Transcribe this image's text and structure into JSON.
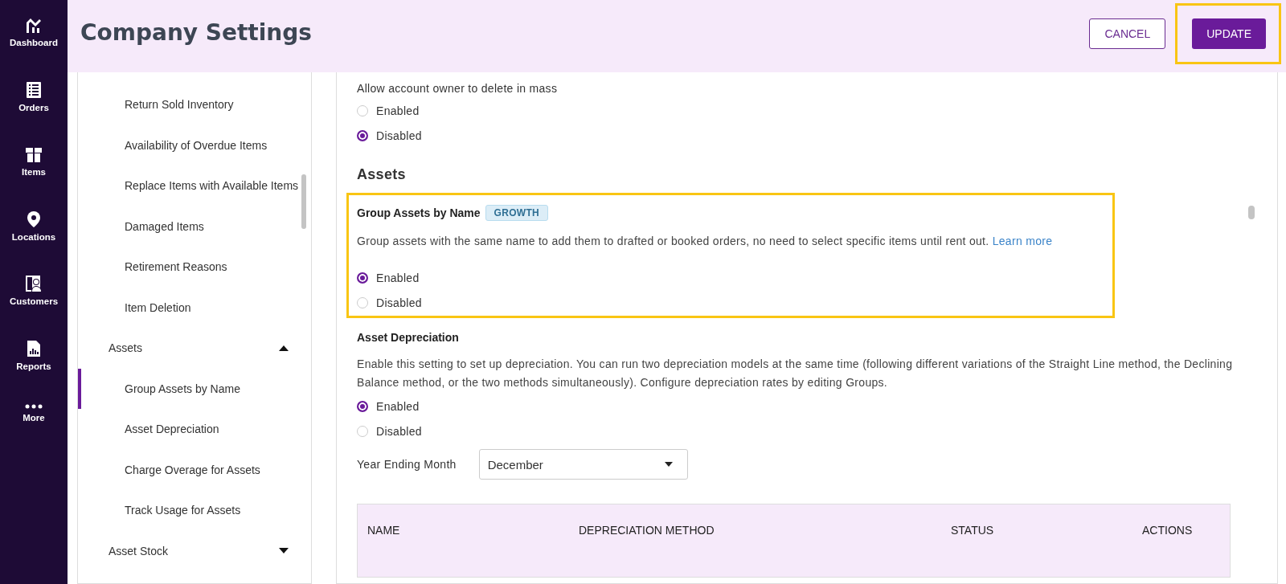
{
  "nav": [
    {
      "label": "Dashboard"
    },
    {
      "label": "Orders"
    },
    {
      "label": "Items"
    },
    {
      "label": "Locations"
    },
    {
      "label": "Customers"
    },
    {
      "label": "Reports"
    },
    {
      "label": "More"
    }
  ],
  "header": {
    "title": "Company Settings",
    "cancel": "CANCEL",
    "update": {
      "label": "UPDATE",
      "highlighted": true
    }
  },
  "settings_nav": [
    {
      "label": "Return Sold Inventory",
      "selected": false
    },
    {
      "label": "Availability of Overdue Items",
      "selected": false
    },
    {
      "label": "Replace Items with Available Items",
      "selected": false
    },
    {
      "label": "Damaged Items",
      "selected": false
    },
    {
      "label": "Retirement Reasons",
      "selected": false
    },
    {
      "label": "Item Deletion",
      "selected": false
    },
    {
      "label": "Assets",
      "expanded": true,
      "children": [
        {
          "label": "Group Assets by Name",
          "selected": true
        },
        {
          "label": "Asset Depreciation",
          "selected": false
        },
        {
          "label": "Charge Overage for Assets",
          "selected": false
        },
        {
          "label": "Track Usage for Assets",
          "selected": false
        }
      ]
    },
    {
      "label": "Asset Stock",
      "expanded": false
    }
  ],
  "content": {
    "mass_delete": {
      "label": "Allow account owner to delete in mass",
      "options": [
        {
          "label": "Enabled",
          "selected": false
        },
        {
          "label": "Disabled",
          "selected": true
        }
      ]
    },
    "section_title": "Assets",
    "group_assets": {
      "title": "Group Assets by Name",
      "badge": "GROWTH",
      "highlighted": true,
      "description": "Group assets with the same name to add them to drafted or booked orders, no need to select specific items until rent out.",
      "link": "Learn more",
      "options": [
        {
          "label": "Enabled",
          "selected": true
        },
        {
          "label": "Disabled",
          "selected": false
        }
      ]
    },
    "depreciation": {
      "title": "Asset Depreciation",
      "description": "Enable this setting to set up depreciation. You can run two depreciation models at the same time (following different variations of the Straight Line method, the Declining Balance method, or the two methods simultaneously). Configure depreciation rates by editing Groups.",
      "options": [
        {
          "label": "Enabled",
          "selected": true
        },
        {
          "label": "Disabled",
          "selected": false
        }
      ],
      "month_label": "Year Ending Month",
      "month_value": "December"
    },
    "table": {
      "columns": [
        "NAME",
        "DEPRECIATION METHOD",
        "STATUS",
        "ACTIONS"
      ]
    }
  }
}
